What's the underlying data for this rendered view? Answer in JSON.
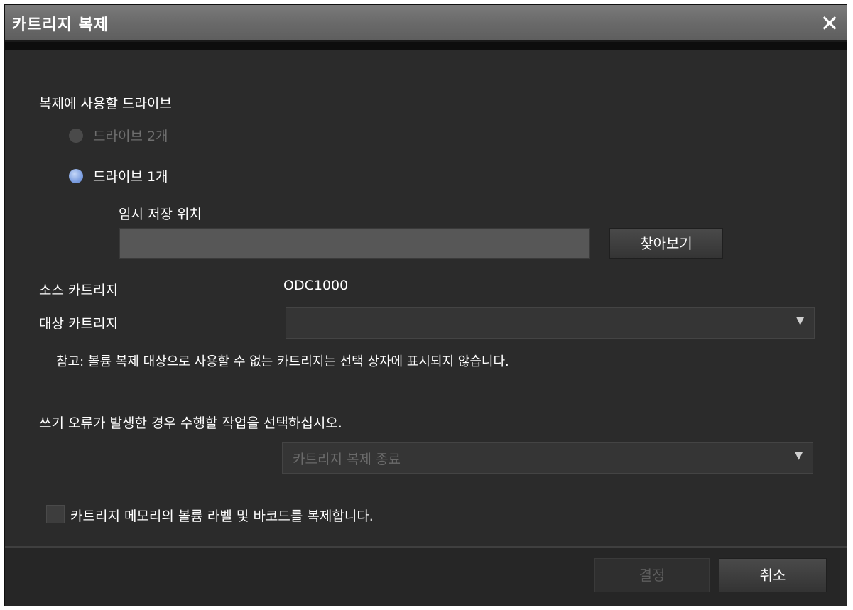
{
  "dialog": {
    "title": "카트리지 복제",
    "drive_section_label": "복제에 사용할 드라이브",
    "option_two_drives": "드라이브 2개",
    "option_one_drive": "드라이브 1개",
    "temp_location_label": "임시 저장 위치",
    "temp_location_value": "",
    "browse_button": "찾아보기",
    "source_label": "소스 카트리지",
    "source_value": "ODC1000",
    "target_label": "대상 카트리지",
    "target_value": "",
    "note": "참고: 볼륨 복제 대상으로 사용할 수 없는 카트리지는 선택 상자에 표시되지 않습니다.",
    "error_action_label": "쓰기 오류가 발생한 경우 수행할 작업을 선택하십시오.",
    "error_action_value": "카트리지 복제 종료",
    "copy_label_checkbox": "카트리지 메모리의 볼륨 라벨 및 바코드를 복제합니다.",
    "ok_button": "결정",
    "cancel_button": "취소"
  }
}
